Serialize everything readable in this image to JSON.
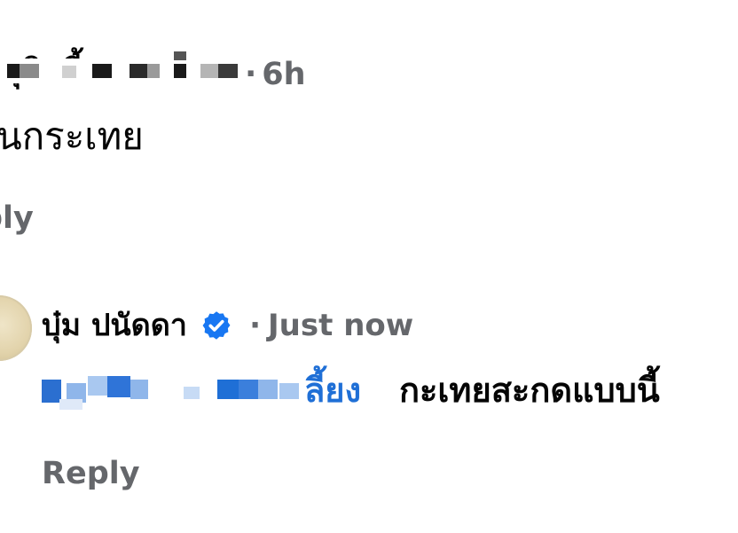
{
  "comments": [
    {
      "author": "ชุติ                  เลี้ยง",
      "author_redacted": true,
      "time": "6h",
      "separator": "·",
      "text": "นกระเทย",
      "reply_label": "ply"
    },
    {
      "author": "บุ๋ม ปนัดดา",
      "verified": true,
      "separator": "·",
      "time": "Just now",
      "mention_visible": "ลี้ยง",
      "mention_redacted": true,
      "text": "กะเทยสะกดแบบนี้",
      "reply_label": "Reply"
    }
  ],
  "colors": {
    "name": "#050505",
    "meta": "#65676b",
    "mention": "#1f6fd6",
    "verified_badge": "#1877f2",
    "background": "#ffffff"
  },
  "icons": {
    "verified": "verified-badge-icon",
    "avatar": "profile-avatar"
  }
}
